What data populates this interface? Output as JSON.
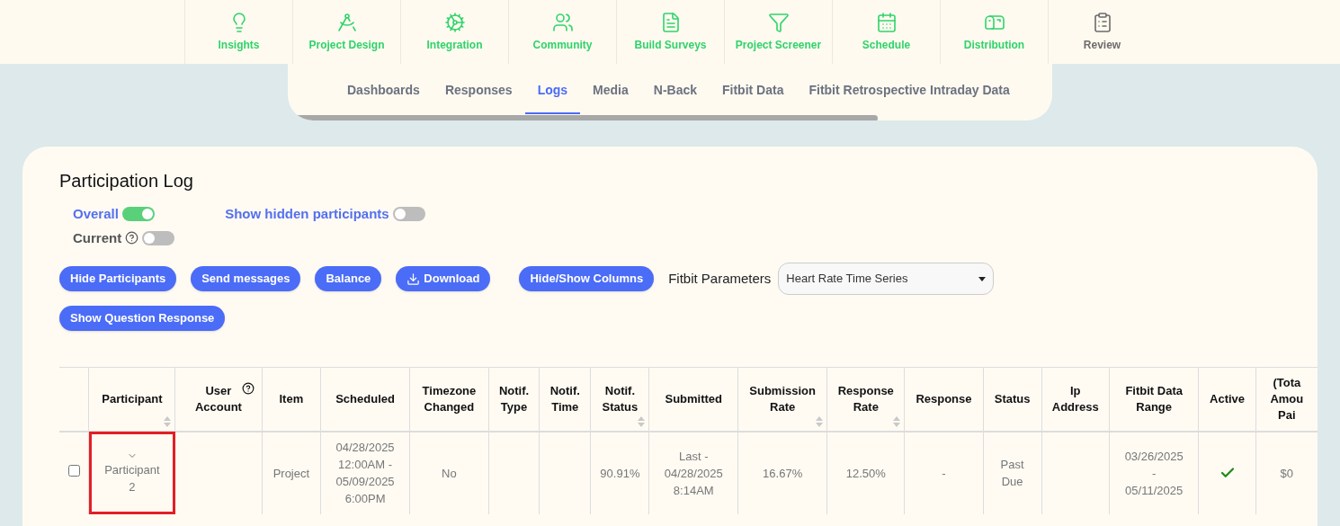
{
  "nav": [
    {
      "label": "Insights",
      "active": true
    },
    {
      "label": "Project Design",
      "active": true
    },
    {
      "label": "Integration",
      "active": true
    },
    {
      "label": "Community",
      "active": true
    },
    {
      "label": "Build Surveys",
      "active": true
    },
    {
      "label": "Project Screener",
      "active": true
    },
    {
      "label": "Schedule",
      "active": true
    },
    {
      "label": "Distribution",
      "active": true
    },
    {
      "label": "Review",
      "active": false
    }
  ],
  "tabs": [
    {
      "label": "Dashboards",
      "selected": false
    },
    {
      "label": "Responses",
      "selected": false
    },
    {
      "label": "Logs",
      "selected": true
    },
    {
      "label": "Media",
      "selected": false
    },
    {
      "label": "N-Back",
      "selected": false
    },
    {
      "label": "Fitbit Data",
      "selected": false
    },
    {
      "label": "Fitbit Retrospective Intraday Data",
      "selected": false
    }
  ],
  "title": "Participation Log",
  "toggles": [
    {
      "label": "Overall",
      "on": true,
      "help": false,
      "kind": "primary"
    },
    {
      "label": "Current",
      "on": false,
      "help": true,
      "kind": "secondary"
    },
    {
      "label": "Show hidden participants",
      "on": false,
      "help": false,
      "kind": "primary"
    }
  ],
  "buttons": [
    {
      "label": "Hide Participants",
      "icon": false
    },
    {
      "label": "Send messages",
      "icon": false
    },
    {
      "label": "Balance",
      "icon": false
    },
    {
      "label": "Download",
      "icon": true
    },
    {
      "label": "Hide/Show Columns",
      "icon": false
    },
    {
      "label": "Show Question Response",
      "icon": false
    }
  ],
  "fitbit_parameters": {
    "label": "Fitbit Parameters",
    "value": "Heart Rate Time Series"
  },
  "table": {
    "columns": [
      {
        "lines": [
          "Participant"
        ],
        "sortable": true,
        "help": false
      },
      {
        "lines": [
          "User",
          "Account"
        ],
        "sortable": false,
        "help": true
      },
      {
        "lines": [
          "Item"
        ],
        "sortable": false,
        "help": false
      },
      {
        "lines": [
          "Scheduled"
        ],
        "sortable": false,
        "help": false
      },
      {
        "lines": [
          "Timezone",
          "Changed"
        ],
        "sortable": false,
        "help": false
      },
      {
        "lines": [
          "Notif.",
          "Type"
        ],
        "sortable": false,
        "help": false
      },
      {
        "lines": [
          "Notif.",
          "Time"
        ],
        "sortable": false,
        "help": false
      },
      {
        "lines": [
          "Notif.",
          "Status"
        ],
        "sortable": true,
        "help": false
      },
      {
        "lines": [
          "Submitted"
        ],
        "sortable": false,
        "help": false
      },
      {
        "lines": [
          "Submission",
          "Rate"
        ],
        "sortable": true,
        "help": false
      },
      {
        "lines": [
          "Response",
          "Rate"
        ],
        "sortable": true,
        "help": false
      },
      {
        "lines": [
          "Response"
        ],
        "sortable": false,
        "help": false
      },
      {
        "lines": [
          "Status"
        ],
        "sortable": false,
        "help": false
      },
      {
        "lines": [
          "Ip",
          "Address"
        ],
        "sortable": false,
        "help": false
      },
      {
        "lines": [
          "Fitbit Data",
          "Range"
        ],
        "sortable": false,
        "help": false
      },
      {
        "lines": [
          "Active"
        ],
        "sortable": false,
        "help": false
      },
      {
        "lines": [
          "(Tota",
          "Amou",
          "Pai"
        ],
        "sortable": false,
        "help": false
      }
    ],
    "rows": [
      {
        "checked": false,
        "expanded": false,
        "outlined": true,
        "active": true,
        "cells": [
          [
            "Participant",
            "2"
          ],
          [],
          [
            "Project"
          ],
          [
            "04/28/2025",
            "12:00AM -",
            "05/09/2025",
            "6:00PM"
          ],
          [
            "No"
          ],
          [],
          [],
          [
            "90.91%"
          ],
          [
            "Last -",
            "04/28/2025",
            "8:14AM"
          ],
          [
            "16.67%"
          ],
          [
            "12.50%"
          ],
          [
            "-"
          ],
          [
            "Past",
            "Due"
          ],
          [],
          [
            "03/26/2025",
            "-",
            "05/11/2025"
          ],
          [],
          [
            "$0"
          ]
        ]
      }
    ]
  }
}
